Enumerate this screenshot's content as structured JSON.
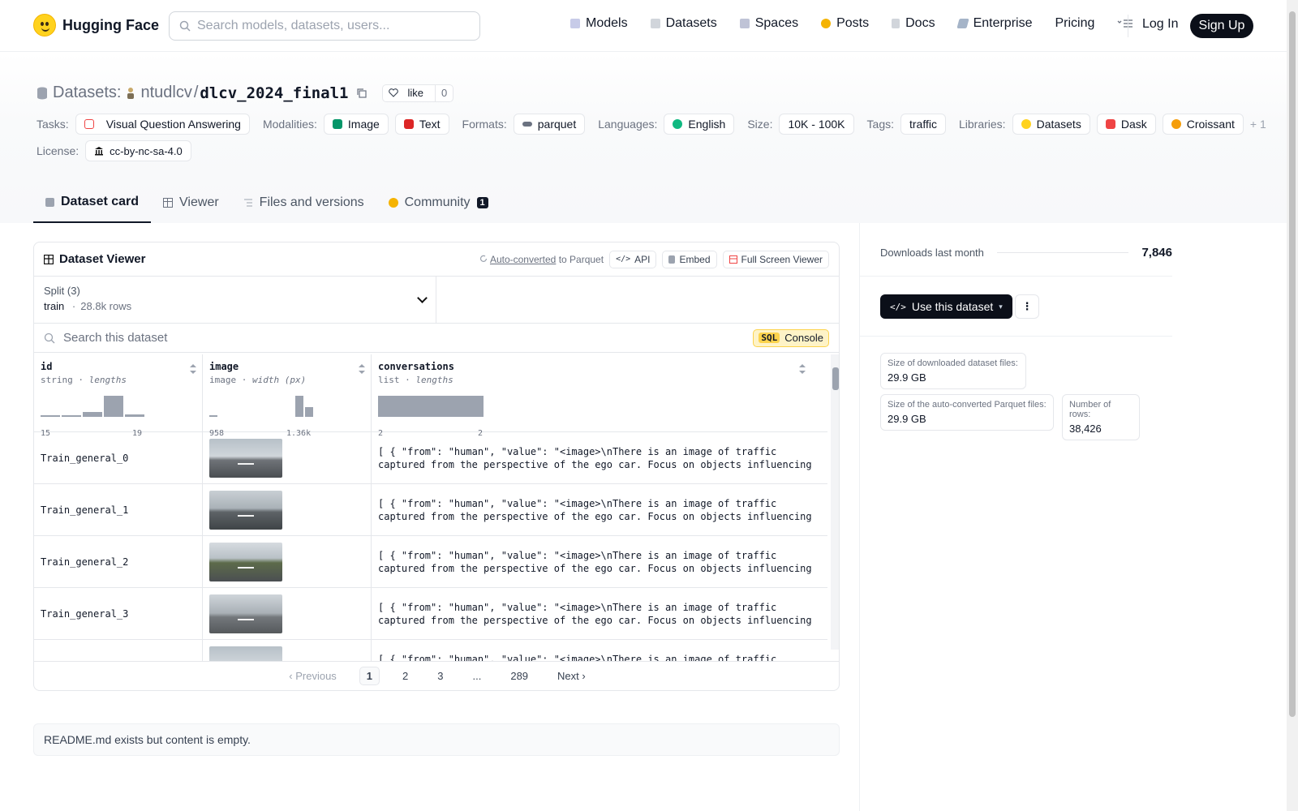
{
  "nav": {
    "brand": "Hugging Face",
    "search_placeholder": "Search models, datasets, users...",
    "links": [
      "Models",
      "Datasets",
      "Spaces",
      "Posts",
      "Docs",
      "Enterprise",
      "Pricing"
    ],
    "login": "Log In",
    "signup": "Sign Up"
  },
  "header": {
    "section": "Datasets:",
    "owner": "ntudlcv",
    "slash": "/",
    "repo": "dlcv_2024_final1",
    "like_label": "like",
    "like_count": "0",
    "tasks_label": "Tasks:",
    "task": "Visual Question Answering",
    "modalities_label": "Modalities:",
    "modality_1": "Image",
    "modality_2": "Text",
    "formats_label": "Formats:",
    "format": "parquet",
    "languages_label": "Languages:",
    "language": "English",
    "size_label": "Size:",
    "size": "10K - 100K",
    "tags_label": "Tags:",
    "tag": "traffic",
    "libraries_label": "Libraries:",
    "library_1": "Datasets",
    "library_2": "Dask",
    "library_3": "Croissant",
    "more": "+ 1",
    "license_label": "License:",
    "license": "cc-by-nc-sa-4.0"
  },
  "tabs": {
    "card": "Dataset card",
    "viewer": "Viewer",
    "files": "Files and versions",
    "community": "Community",
    "community_count": "1"
  },
  "viewer": {
    "title": "Dataset Viewer",
    "auto_converted": "Auto-converted",
    "to_parquet": "to Parquet",
    "api": "API",
    "embed": "Embed",
    "fullscreen": "Full Screen Viewer",
    "split_label": "Split (3)",
    "split_name": "train",
    "split_dot": "·",
    "split_rows": "28.8k rows",
    "search_placeholder": "Search this dataset",
    "sql": "SQL",
    "console": "Console",
    "columns": {
      "id": {
        "name": "id",
        "type": "string",
        "stat": "lengths",
        "min": "15",
        "max": "19"
      },
      "image": {
        "name": "image",
        "type": "image",
        "stat": "width (px)",
        "min": "958",
        "max": "1.36k"
      },
      "conversations": {
        "name": "conversations",
        "type": "list",
        "stat": "lengths",
        "min": "2",
        "max": "2"
      }
    },
    "rows": [
      {
        "id": "Train_general_0",
        "conv": "[ { \"from\": \"human\", \"value\": \"<image>\\nThere is an image of traffic\ncaptured from the perspective of the ego car. Focus on objects influencing…"
      },
      {
        "id": "Train_general_1",
        "conv": "[ { \"from\": \"human\", \"value\": \"<image>\\nThere is an image of traffic\ncaptured from the perspective of the ego car. Focus on objects influencing…"
      },
      {
        "id": "Train_general_2",
        "conv": "[ { \"from\": \"human\", \"value\": \"<image>\\nThere is an image of traffic\ncaptured from the perspective of the ego car. Focus on objects influencing…"
      },
      {
        "id": "Train_general_3",
        "conv": "[ { \"from\": \"human\", \"value\": \"<image>\\nThere is an image of traffic\ncaptured from the perspective of the ego car. Focus on objects influencing…"
      },
      {
        "id": "",
        "conv": "[ { \"from\": \"human\", \"value\": \"<image>\\nThere is an image of traffic"
      }
    ],
    "pager": {
      "prev": "Previous",
      "p1": "1",
      "p2": "2",
      "p3": "3",
      "ellipsis": "...",
      "last": "289",
      "next": "Next"
    }
  },
  "readme": "README.md exists but content is empty.",
  "sidebar": {
    "downloads_label": "Downloads last month",
    "downloads": "7,846",
    "use_button": "Use this dataset",
    "size_dl_label": "Size of downloaded dataset files:",
    "size_dl": "29.9 GB",
    "size_pq_label": "Size of the auto-converted Parquet files:",
    "size_pq": "29.9 GB",
    "rows_label": "Number of rows:",
    "rows": "38,426"
  }
}
